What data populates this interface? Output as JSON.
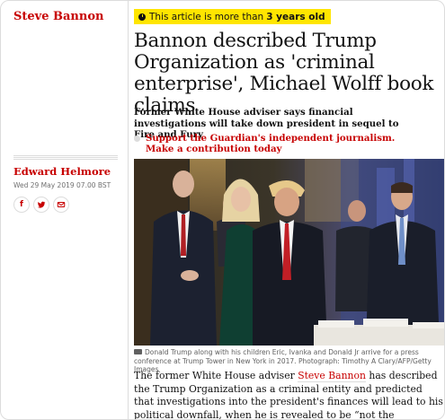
{
  "section": {
    "tag": "Steve Bannon"
  },
  "age_warning": {
    "prefix": "This article is more than",
    "age": "3 years old"
  },
  "article": {
    "headline": "Bannon described Trump Organization as 'criminal enterprise', Michael Wolff book claims",
    "standfirst": "Former White House adviser says financial investigations will take down president in sequel to Fire and Fury",
    "support_link": "Support the Guardian's independent journalism. Make a contribution today",
    "image_caption": "Donald Trump along with his children Eric, Ivanka and Donald Jr arrive for a press conference at Trump Tower in New York in 2017. Photograph: Timothy A Clary/AFP/Getty Images",
    "body_before_link": "The former White House adviser ",
    "body_link": "Steve Bannon",
    "body_after_link": " has described the Trump Organization as a criminal entity and predicted that investigations into the president's finances will lead to his political downfall, when he is revealed to be “not the billionaire he said he was, just another scumbag”."
  },
  "byline": {
    "author": "Edward Helmore",
    "date": "Wed 29 May 2019 07.00 BST"
  },
  "share": {
    "facebook_glyph": "f",
    "icons": [
      "facebook-icon",
      "twitter-icon",
      "email-icon"
    ]
  },
  "colors": {
    "accent": "#c70000",
    "warning_bg": "#ffe500",
    "rule": "#dcdcdc"
  }
}
